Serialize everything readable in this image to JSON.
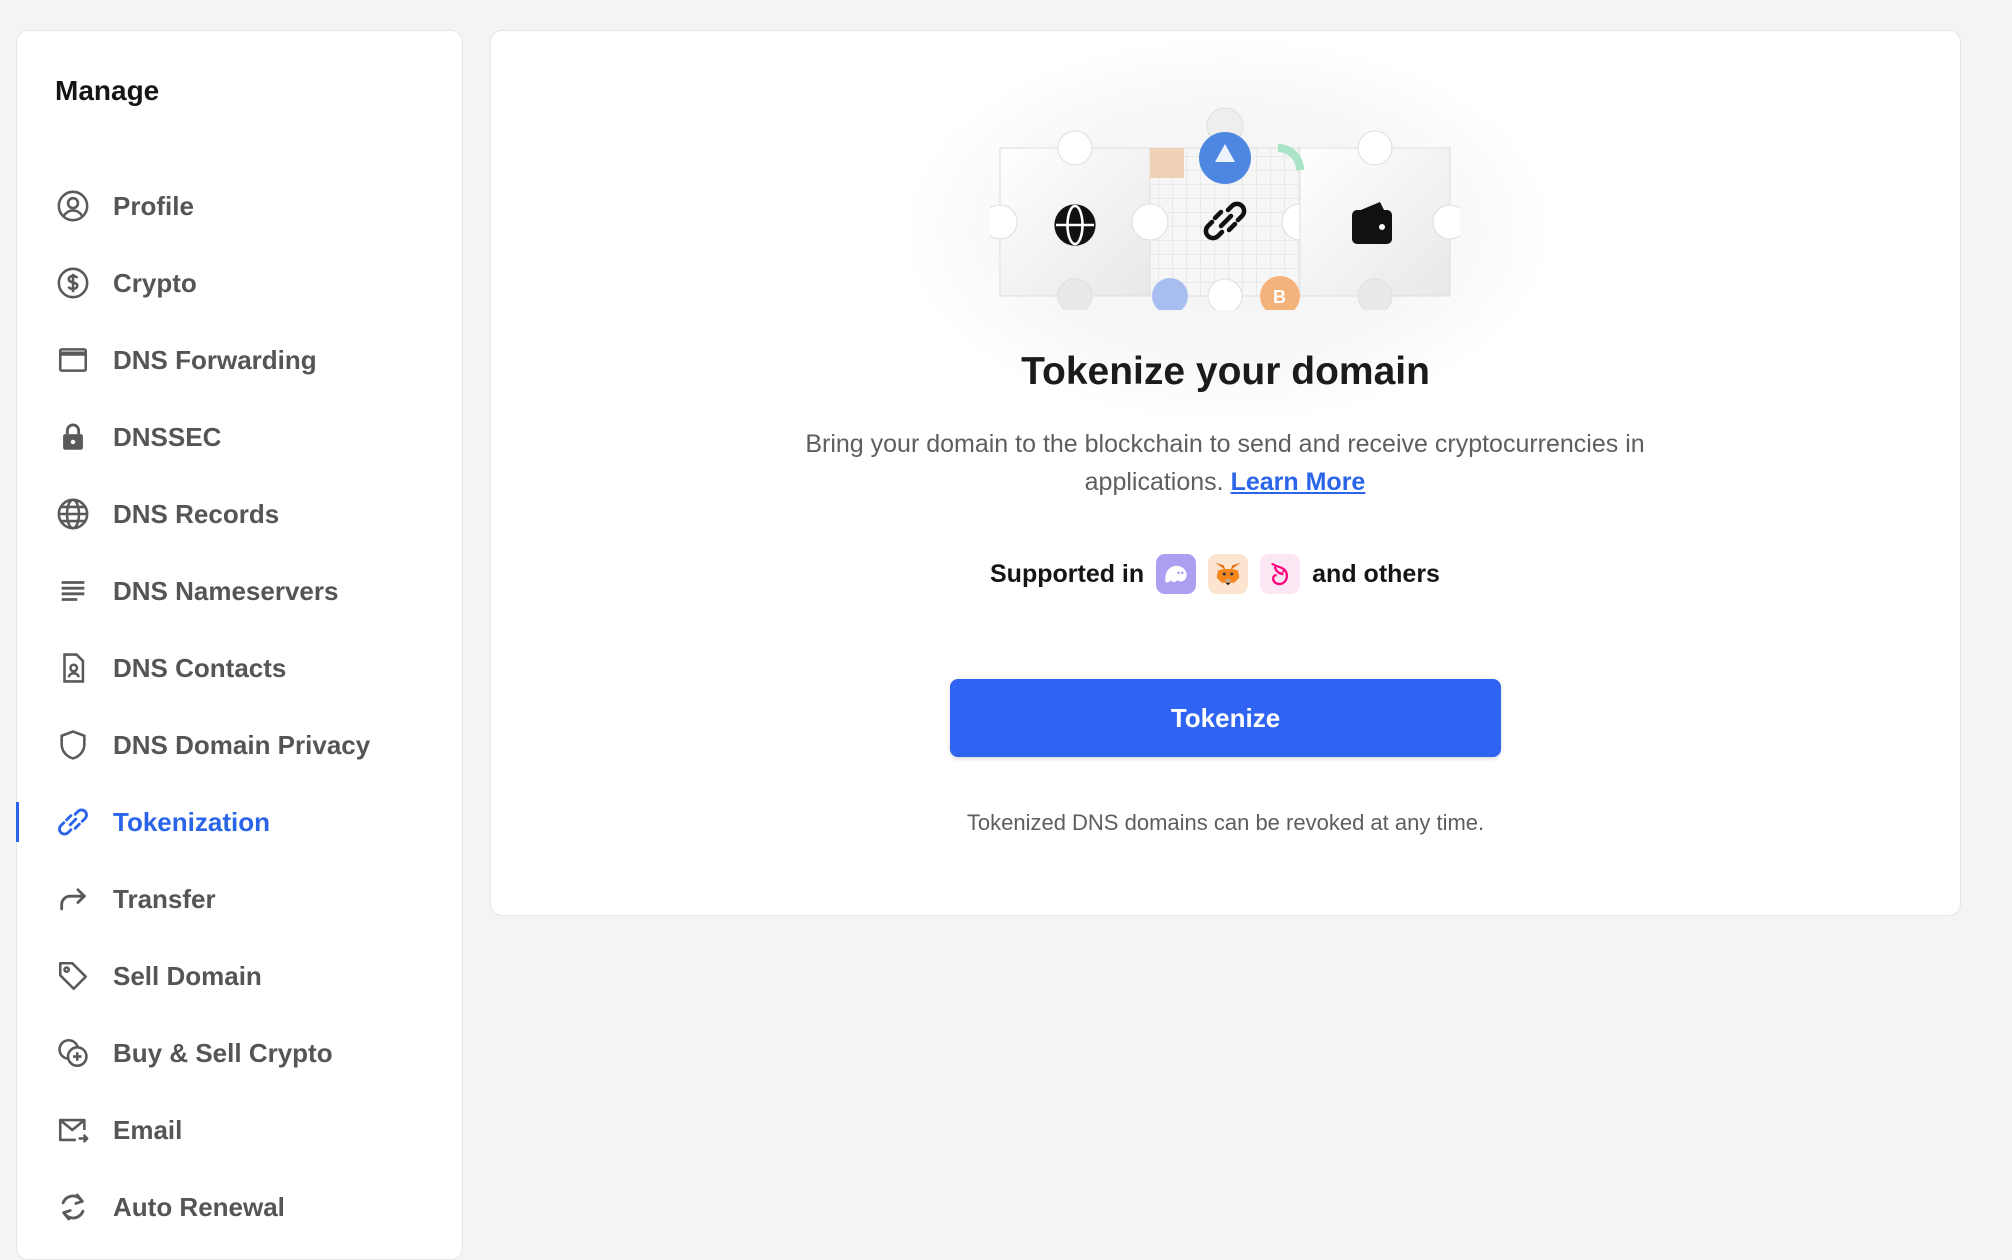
{
  "sidebar": {
    "title": "Manage",
    "items": [
      {
        "label": "Profile",
        "icon": "user-circle-icon"
      },
      {
        "label": "Crypto",
        "icon": "dollar-circle-icon"
      },
      {
        "label": "DNS Forwarding",
        "icon": "window-icon"
      },
      {
        "label": "DNSSEC",
        "icon": "lock-icon"
      },
      {
        "label": "DNS Records",
        "icon": "globe-icon"
      },
      {
        "label": "DNS Nameservers",
        "icon": "lines-icon"
      },
      {
        "label": "DNS Contacts",
        "icon": "contact-card-icon"
      },
      {
        "label": "DNS Domain Privacy",
        "icon": "shield-icon"
      },
      {
        "label": "Tokenization",
        "icon": "link-icon",
        "active": true
      },
      {
        "label": "Transfer",
        "icon": "arrow-forward-icon"
      },
      {
        "label": "Sell Domain",
        "icon": "tag-icon"
      },
      {
        "label": "Buy & Sell Crypto",
        "icon": "coins-plus-icon"
      },
      {
        "label": "Email",
        "icon": "mail-icon"
      },
      {
        "label": "Auto Renewal",
        "icon": "refresh-icon"
      }
    ]
  },
  "main": {
    "title": "Tokenize your domain",
    "description": "Bring your domain to the blockchain to send and receive cryptocurrencies in applications.",
    "learn_more": "Learn More",
    "supported_prefix": "Supported in",
    "supported_suffix": "and others",
    "wallets": [
      "phantom-wallet-icon",
      "metamask-wallet-icon",
      "uniswap-wallet-icon"
    ],
    "button_label": "Tokenize",
    "footnote": "Tokenized DNS domains can be revoked at any time."
  },
  "colors": {
    "accent": "#2a64e8",
    "button": "#2f63f2",
    "background": "#f4f4f4",
    "label": "#555555"
  }
}
